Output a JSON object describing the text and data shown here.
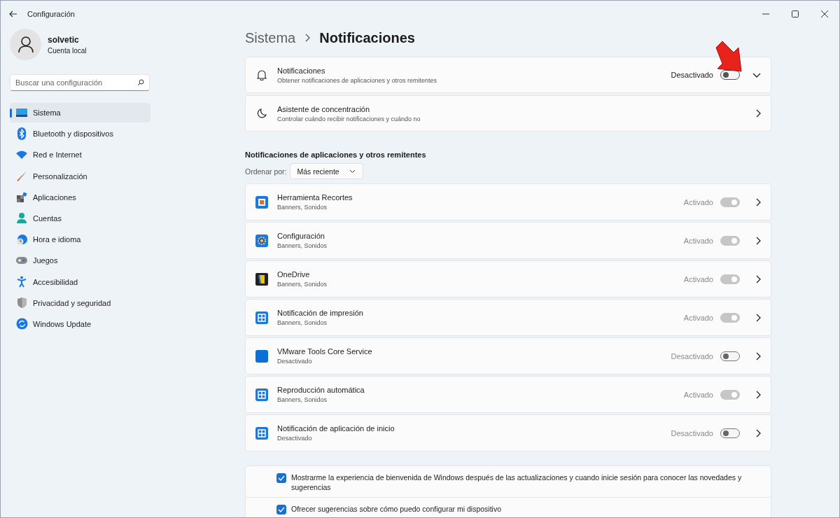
{
  "window": {
    "title": "Configuración"
  },
  "user": {
    "name": "solvetic",
    "account": "Cuenta local"
  },
  "search": {
    "placeholder": "Buscar una configuración"
  },
  "sidebar": {
    "items": [
      {
        "label": "Sistema",
        "selected": true,
        "kind": "display"
      },
      {
        "label": "Bluetooth y dispositivos",
        "selected": false,
        "kind": "bluetooth"
      },
      {
        "label": "Red e Internet",
        "selected": false,
        "kind": "wifi"
      },
      {
        "label": "Personalización",
        "selected": false,
        "kind": "brush"
      },
      {
        "label": "Aplicaciones",
        "selected": false,
        "kind": "apps"
      },
      {
        "label": "Cuentas",
        "selected": false,
        "kind": "person"
      },
      {
        "label": "Hora e idioma",
        "selected": false,
        "kind": "clock"
      },
      {
        "label": "Juegos",
        "selected": false,
        "kind": "gamepad"
      },
      {
        "label": "Accesibilidad",
        "selected": false,
        "kind": "accessibility"
      },
      {
        "label": "Privacidad y seguridad",
        "selected": false,
        "kind": "shield"
      },
      {
        "label": "Windows Update",
        "selected": false,
        "kind": "update"
      }
    ]
  },
  "breadcrumb": [
    "Sistema",
    "Notificaciones"
  ],
  "cards": [
    {
      "kind": "toggle",
      "title": "Notificaciones",
      "subtitle": "Obtener notificaciones de aplicaciones y otros remitentes",
      "state_label": "Desactivado",
      "on": false,
      "expanded": false
    },
    {
      "kind": "link",
      "title": "Asistente de concentración",
      "subtitle": "Controlar cuándo recibir notificaciones y cuándo no"
    }
  ],
  "section_title": "Notificaciones de aplicaciones y otros remitentes",
  "sort": {
    "label": "Ordenar por:",
    "value": "Más reciente"
  },
  "apps": [
    {
      "name": "Herramienta Recortes",
      "detail": "Banners, Sonidos",
      "state_label": "Activado",
      "on": true,
      "disabled": true,
      "kind": "snip"
    },
    {
      "name": "Configuración",
      "detail": "Banners, Sonidos",
      "state_label": "Activado",
      "on": true,
      "disabled": true,
      "kind": "gear"
    },
    {
      "name": "OneDrive",
      "detail": "Banners, Sonidos",
      "state_label": "Activado",
      "on": true,
      "disabled": true,
      "kind": "cloud"
    },
    {
      "name": "Notificación de impresión",
      "detail": "Banners, Sonidos",
      "state_label": "Activado",
      "on": true,
      "disabled": true,
      "kind": "tile"
    },
    {
      "name": "VMware Tools Core Service",
      "detail": "Desactivado",
      "state_label": "Desactivado",
      "on": false,
      "disabled": true,
      "kind": "square"
    },
    {
      "name": "Reproducción automática",
      "detail": "Banners, Sonidos",
      "state_label": "Activado",
      "on": true,
      "disabled": true,
      "kind": "tile"
    },
    {
      "name": "Notificación de aplicación de inicio",
      "detail": "Desactivado",
      "state_label": "Desactivado",
      "on": false,
      "disabled": true,
      "kind": "tile"
    }
  ],
  "checkboxes": [
    {
      "label": "Mostrarme la experiencia de bienvenida de Windows después de las actualizaciones y cuando inicie sesión para conocer las novedades y sugerencias",
      "checked": true
    },
    {
      "label": "Ofrecer sugerencias sobre cómo puedo configurar mi dispositivo",
      "checked": true
    }
  ]
}
